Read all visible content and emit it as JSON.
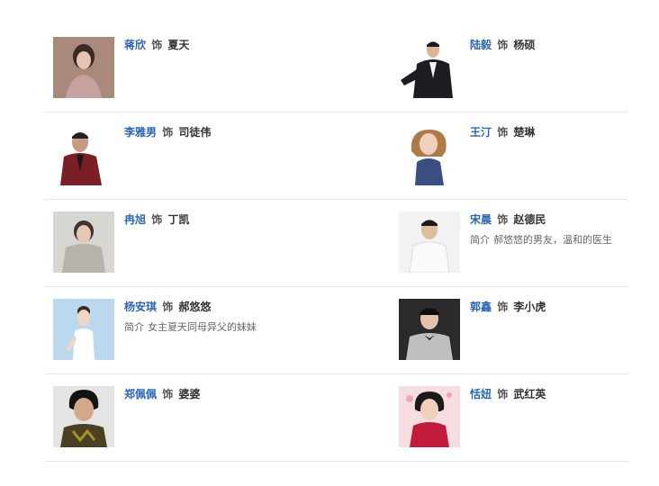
{
  "cast": [
    {
      "actor": "蒋欣",
      "as": "饰",
      "role": "夏天",
      "intro_label": "",
      "intro": ""
    },
    {
      "actor": "陆毅",
      "as": "饰",
      "role": "杨硕",
      "intro_label": "",
      "intro": ""
    },
    {
      "actor": "李雅男",
      "as": "饰",
      "role": "司徒伟",
      "intro_label": "",
      "intro": ""
    },
    {
      "actor": "王汀",
      "as": "饰",
      "role": "楚琳",
      "intro_label": "",
      "intro": ""
    },
    {
      "actor": "冉旭",
      "as": "饰",
      "role": "丁凯",
      "intro_label": "",
      "intro": ""
    },
    {
      "actor": "宋晨",
      "as": "饰",
      "role": "赵德民",
      "intro_label": "简介",
      "intro": "郝悠悠的男友，温和的医生"
    },
    {
      "actor": "杨安琪",
      "as": "饰",
      "role": "郝悠悠",
      "intro_label": "简介",
      "intro": "女主夏天同母异父的妹妹"
    },
    {
      "actor": "郭鑫",
      "as": "饰",
      "role": "李小虎",
      "intro_label": "",
      "intro": ""
    },
    {
      "actor": "郑佩佩",
      "as": "饰",
      "role": "婆婆",
      "intro_label": "",
      "intro": ""
    },
    {
      "actor": "恬妞",
      "as": "饰",
      "role": "武红英",
      "intro_label": "",
      "intro": ""
    }
  ],
  "colors": {
    "actor_link": "#2a66b3",
    "text": "#333333",
    "intro_text": "#666666",
    "divider": "#e6e6e6"
  }
}
